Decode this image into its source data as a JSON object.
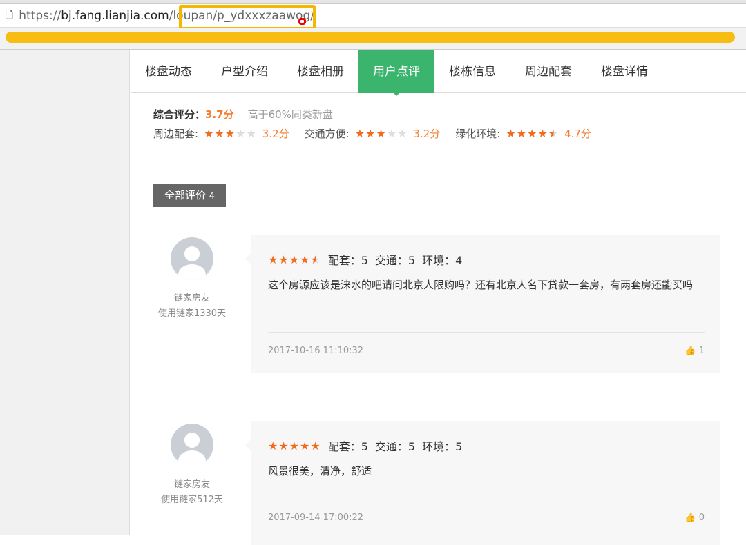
{
  "browser": {
    "url_prefix": "https://",
    "url_domain": "bj.fang.lianjia.com",
    "url_path": "/loupan/p_ydxxxzaawog/"
  },
  "nav": {
    "tabs": [
      "楼盘动态",
      "户型介绍",
      "楼盘相册",
      "用户点评",
      "楼栋信息",
      "周边配套",
      "楼盘详情"
    ],
    "active": 3
  },
  "summary": {
    "overall_label": "综合评分：",
    "overall_score": "3.7分",
    "compare": "高于60%同类新盘",
    "items": [
      {
        "label": "周边配套:",
        "stars": 3,
        "score": "3.2分"
      },
      {
        "label": "交通方便:",
        "stars": 3,
        "score": "3.2分"
      },
      {
        "label": "绿化环境:",
        "stars": 4.5,
        "score": "4.7分"
      }
    ]
  },
  "all_reviews": {
    "label": "全部评价",
    "count": "4"
  },
  "reviews": [
    {
      "user": "链家房友",
      "usage": "使用链家1330天",
      "stars": 4.5,
      "peitao": "配套：5",
      "jiaotong": "交通：5",
      "huanjing": "环境：4",
      "text": "这个房源应该是涞水的吧请问北京人限购吗？还有北京人名下贷款一套房，有两套房还能买吗",
      "date": "2017-10-16 11:10:32",
      "likes": "1"
    },
    {
      "user": "链家房友",
      "usage": "使用链家512天",
      "stars": 5,
      "peitao": "配套：5",
      "jiaotong": "交通：5",
      "huanjing": "环境：5",
      "text": "风景很美，清净，舒适",
      "date": "2017-09-14 17:00:22",
      "likes": "0"
    }
  ],
  "colors": {
    "accent": "#3bb46e",
    "orange": "#f57c2c",
    "highlight": "#f5b800"
  }
}
